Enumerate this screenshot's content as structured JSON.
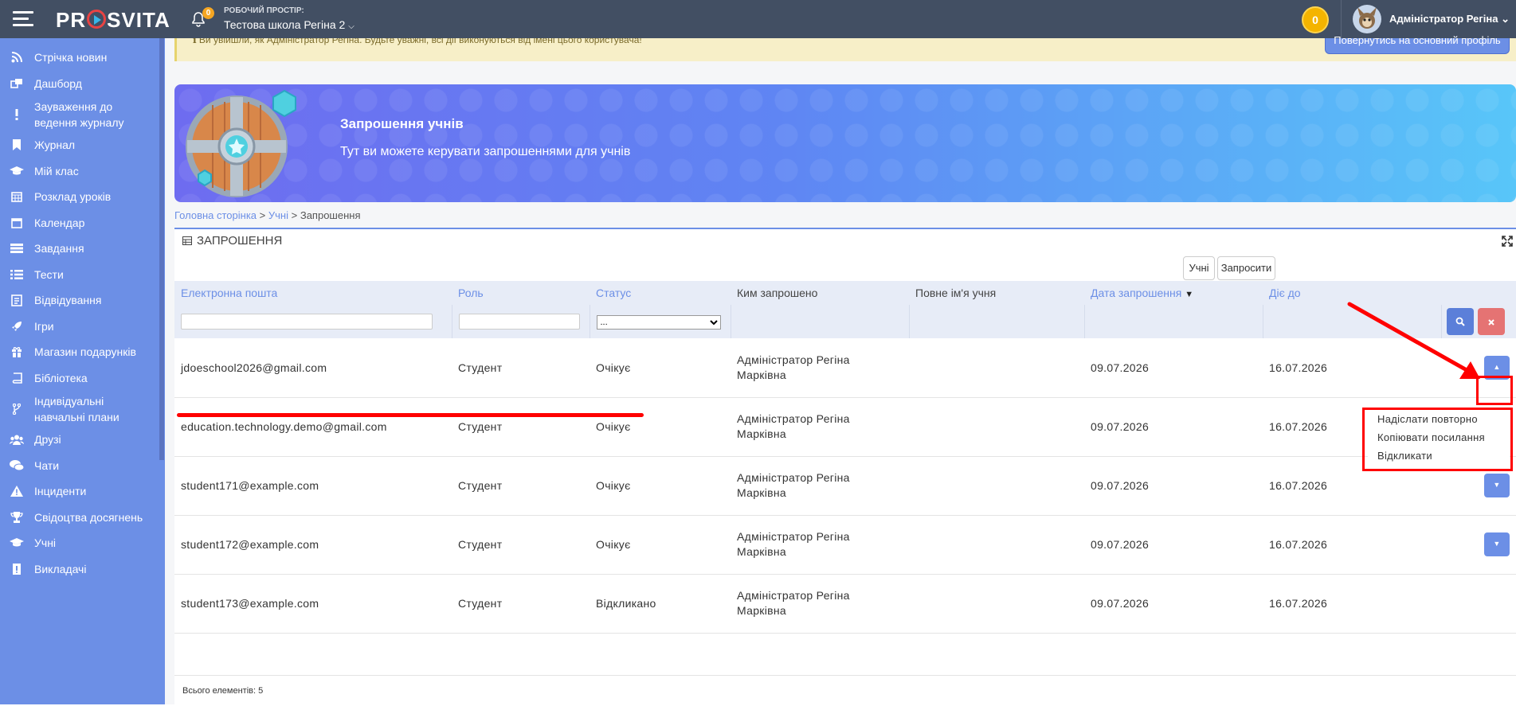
{
  "topbar": {
    "logo": "PROSVITA",
    "logo_pre": "PR",
    "logo_post": "SVITA",
    "notif_count": "0",
    "workspace_label": "РОБОЧИЙ ПРОСТІР:",
    "workspace_name": "Тестова школа Регіна 2",
    "coins": "0",
    "user_name": "Адміністратор Регіна"
  },
  "sidebar": {
    "items": [
      {
        "label": "Стрічка новин",
        "icon": "rss-icon"
      },
      {
        "label": "Дашборд",
        "icon": "dashboard-icon"
      },
      {
        "label": "Зауваження до ведення журналу",
        "icon": "exclamation-icon"
      },
      {
        "label": "Журнал",
        "icon": "bookmark-icon"
      },
      {
        "label": "Мій клас",
        "icon": "graduation-cap-icon"
      },
      {
        "label": "Розклад уроків",
        "icon": "calendar-grid-icon"
      },
      {
        "label": "Календар",
        "icon": "calendar-icon"
      },
      {
        "label": "Завдання",
        "icon": "tasks-icon"
      },
      {
        "label": "Тести",
        "icon": "list-icon"
      },
      {
        "label": "Відвідування",
        "icon": "attendance-icon"
      },
      {
        "label": "Ігри",
        "icon": "rocket-icon"
      },
      {
        "label": "Магазин подарунків",
        "icon": "gift-icon"
      },
      {
        "label": "Бібліотека",
        "icon": "book-icon"
      },
      {
        "label": "Індивідуальні навчальні плани",
        "icon": "branch-icon"
      },
      {
        "label": "Друзі",
        "icon": "users-icon"
      },
      {
        "label": "Чати",
        "icon": "chat-icon"
      },
      {
        "label": "Інциденти",
        "icon": "warning-icon"
      },
      {
        "label": "Свідоцтва досягнень",
        "icon": "trophy-icon"
      },
      {
        "label": "Учні",
        "icon": "graduation-cap-icon"
      },
      {
        "label": "Викладачі",
        "icon": "teacher-icon"
      }
    ]
  },
  "notice": {
    "text": "Ви увійшли, як Адміністратор Регіна. Будьте уважні, всі дії виконуються від імені цього користувача!",
    "back_button": "Повернутись на основний профіль"
  },
  "banner": {
    "title": "Запрошення учнів",
    "subtitle": "Тут ви можете керувати запрошеннями для учнів"
  },
  "breadcrumb": {
    "home": "Головна сторінка",
    "students": "Учні",
    "current": "Запрошення",
    "sep": ">"
  },
  "panel": {
    "title": "ЗАПРОШЕННЯ",
    "btn_students": "Учні",
    "btn_invite": "Запросити",
    "columns": {
      "email": "Електронна пошта",
      "role": "Роль",
      "status": "Статус",
      "invited_by": "Ким запрошено",
      "full_name": "Повне ім'я учня",
      "invite_date": "Дата запрошення",
      "valid_until": "Діє до"
    },
    "status_filter": "...",
    "rows": [
      {
        "email": "jdoeschool2026@gmail.com",
        "role": "Студент",
        "status": "Очікує",
        "by1": "Адміністратор Регіна",
        "by2": "Марківна",
        "name": "",
        "date": "09.07.2026",
        "until": "16.07.2026"
      },
      {
        "email": "education.technology.demo@gmail.com",
        "role": "Студент",
        "status": "Очікує",
        "by1": "Адміністратор Регіна",
        "by2": "Марківна",
        "name": "",
        "date": "09.07.2026",
        "until": "16.07.2026"
      },
      {
        "email": "student171@example.com",
        "role": "Студент",
        "status": "Очікує",
        "by1": "Адміністратор Регіна",
        "by2": "Марківна",
        "name": "",
        "date": "09.07.2026",
        "until": "16.07.2026"
      },
      {
        "email": "student172@example.com",
        "role": "Студент",
        "status": "Очікує",
        "by1": "Адміністратор Регіна",
        "by2": "Марківна",
        "name": "",
        "date": "09.07.2026",
        "until": "16.07.2026"
      },
      {
        "email": "student173@example.com",
        "role": "Студент",
        "status": "Відкликано",
        "by1": "Адміністратор Регіна",
        "by2": "Марківна",
        "name": "",
        "date": "09.07.2026",
        "until": "16.07.2026"
      }
    ],
    "total": "Всього елементів: 5"
  },
  "dropdown_menu": {
    "resend": "Надіслати повторно",
    "copy_link": "Копіювати посилання",
    "revoke": "Відкликати"
  },
  "colors": {
    "topbar": "#424f63",
    "sidebar": "#6c8fe6",
    "accent": "#6c8fe6",
    "danger": "#e57373",
    "annotation": "#ff0000"
  }
}
